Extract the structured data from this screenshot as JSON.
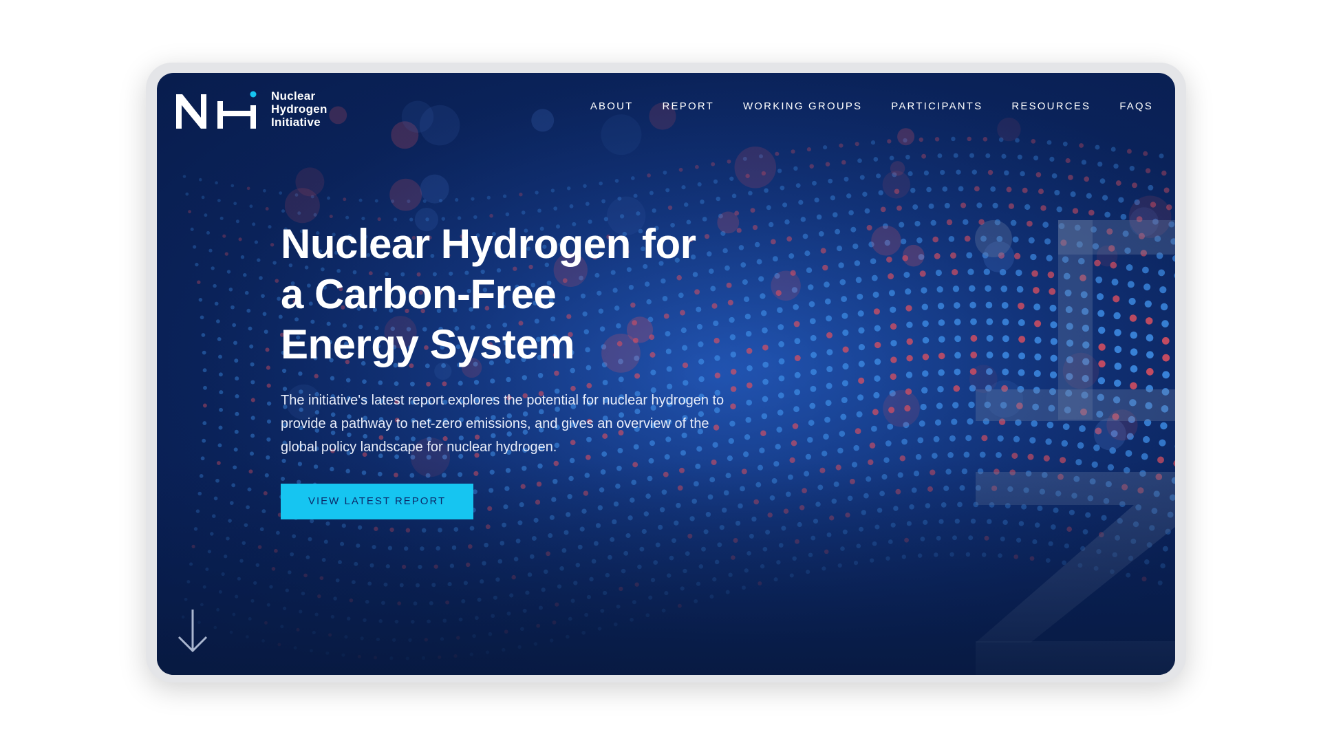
{
  "logo": {
    "mark": "NH",
    "lines": [
      "Nuclear",
      "Hydrogen",
      "Initiative"
    ]
  },
  "nav": {
    "items": [
      "ABOUT",
      "REPORT",
      "WORKING GROUPS",
      "PARTICIPANTS",
      "RESOURCES",
      "FAQS"
    ]
  },
  "hero": {
    "title_lines": [
      "Nuclear Hydrogen for",
      "a Carbon-Free",
      "Energy System"
    ],
    "description": "The initiative's latest report explores the potential for nuclear hydrogen to provide a pathway to net-zero emissions, and gives an overview of the global policy landscape for nuclear hydrogen.",
    "cta_label": "VIEW LATEST REPORT"
  },
  "icons": {
    "scroll": "arrow-down-icon",
    "decor": "large-h2-watermark-icon"
  },
  "colors": {
    "background": "#0a2259",
    "accent": "#16c5f1",
    "text": "#ffffff",
    "dot_blue": "#3f8fe8",
    "dot_red": "#e0505f"
  }
}
